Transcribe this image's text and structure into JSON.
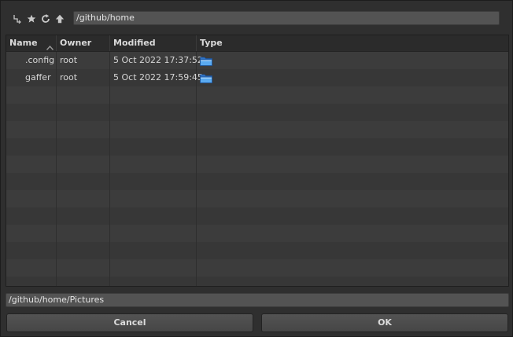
{
  "toolbar": {
    "icons": [
      "up-level-icon",
      "bookmark-star-icon",
      "refresh-icon",
      "home-up-arrow-icon"
    ]
  },
  "location": {
    "path": "/github/home"
  },
  "table": {
    "columns": [
      "Name",
      "Owner",
      "Modified",
      "Type"
    ],
    "sorted_column": "Name",
    "rows": [
      {
        "name": ".config",
        "owner": "root",
        "modified": "5 Oct 2022 17:37:52",
        "type_icon": "folder-icon"
      },
      {
        "name": "gaffer",
        "owner": "root",
        "modified": "5 Oct 2022 17:59:45",
        "type_icon": "folder-icon"
      }
    ]
  },
  "selection": {
    "path": "/github/home/Pictures"
  },
  "buttons": {
    "cancel_label": "Cancel",
    "ok_label": "OK"
  },
  "colors": {
    "background": "#2f2f2f",
    "field": "#535353",
    "folder": "#4a9ee8"
  }
}
